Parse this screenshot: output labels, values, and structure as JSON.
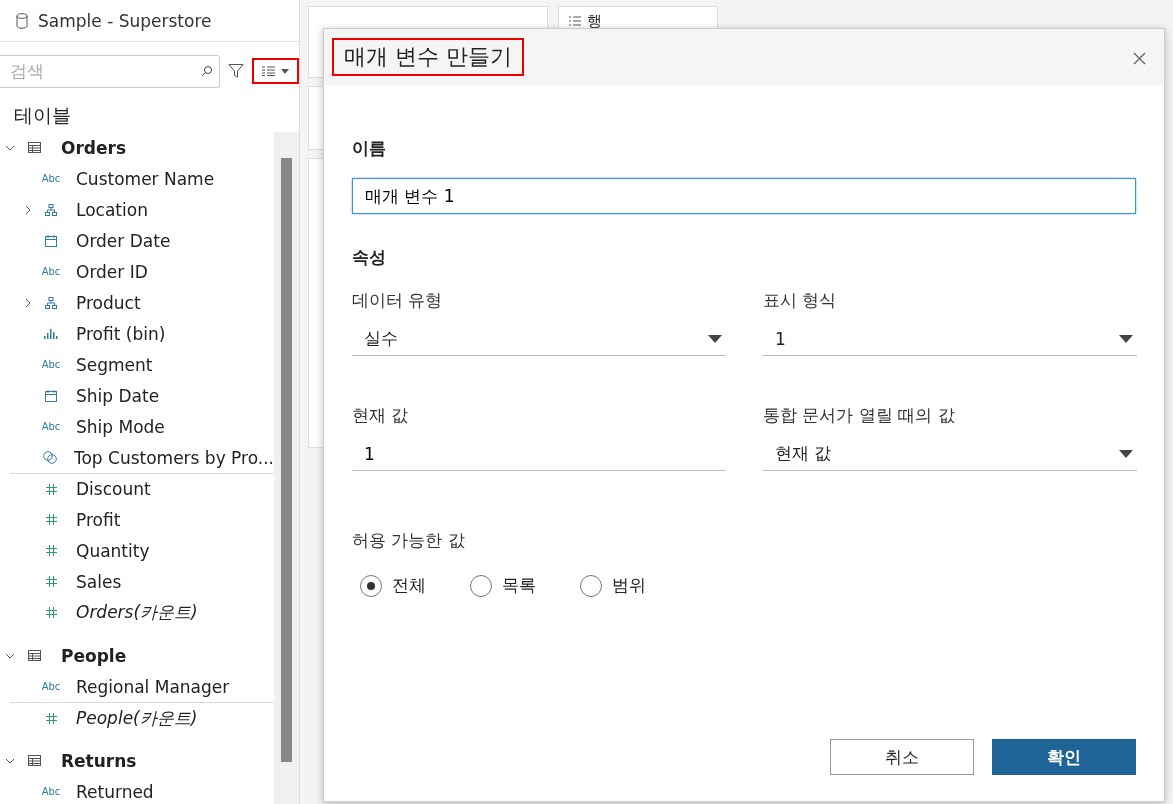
{
  "data_source": {
    "name": "Sample - Superstore"
  },
  "search": {
    "placeholder": "검색"
  },
  "tables_heading": "테이블",
  "tables": [
    {
      "name": "Orders",
      "expanded": true,
      "fields": [
        {
          "kind": "string",
          "badge": "Abc",
          "label": "Customer Name",
          "expandable": false,
          "generated": false
        },
        {
          "kind": "hierarchy",
          "label": "Location",
          "expandable": true,
          "generated": false
        },
        {
          "kind": "date",
          "label": "Order Date",
          "expandable": false,
          "generated": false
        },
        {
          "kind": "string",
          "badge": "Abc",
          "label": "Order ID",
          "expandable": false,
          "generated": false
        },
        {
          "kind": "hierarchy",
          "label": "Product",
          "expandable": true,
          "generated": false
        },
        {
          "kind": "bin",
          "label": "Profit (bin)",
          "expandable": false,
          "generated": false
        },
        {
          "kind": "string",
          "badge": "Abc",
          "label": "Segment",
          "expandable": false,
          "generated": false
        },
        {
          "kind": "date",
          "label": "Ship Date",
          "expandable": false,
          "generated": false
        },
        {
          "kind": "string",
          "badge": "Abc",
          "label": "Ship Mode",
          "expandable": false,
          "generated": false
        },
        {
          "kind": "set",
          "label": "Top Customers by Pro...",
          "expandable": false,
          "generated": false
        },
        {
          "kind": "measure",
          "label": "Discount",
          "expandable": false,
          "generated": false
        },
        {
          "kind": "measure",
          "label": "Profit",
          "expandable": false,
          "generated": false
        },
        {
          "kind": "measure",
          "label": "Quantity",
          "expandable": false,
          "generated": false
        },
        {
          "kind": "measure",
          "label": "Sales",
          "expandable": false,
          "generated": false
        },
        {
          "kind": "measure",
          "label": "Orders(카운트)",
          "expandable": false,
          "generated": true
        }
      ]
    },
    {
      "name": "People",
      "expanded": true,
      "fields": [
        {
          "kind": "string",
          "badge": "Abc",
          "label": "Regional Manager",
          "expandable": false,
          "generated": false
        },
        {
          "kind": "measure",
          "label": "People(카운트)",
          "expandable": false,
          "generated": true
        }
      ]
    },
    {
      "name": "Returns",
      "expanded": true,
      "fields": [
        {
          "kind": "string",
          "badge": "Abc",
          "label": "Returned",
          "expandable": false,
          "generated": false
        }
      ]
    }
  ],
  "shelf": {
    "label": "행"
  },
  "dialog": {
    "title": "매개 변수 만들기",
    "name_label": "이름",
    "name_value": "매개 변수 1",
    "properties_heading": "속성",
    "properties": [
      {
        "kind": "select",
        "label": "데이터 유형",
        "value": "실수"
      },
      {
        "kind": "select",
        "label": "표시 형식",
        "value": "1"
      },
      {
        "kind": "input",
        "label": "현재 값",
        "value": "1"
      },
      {
        "kind": "select",
        "label": "통합 문서가 열릴 때의 값",
        "value": "현재 값"
      }
    ],
    "allowed_label": "허용 가능한 값",
    "allowed_options": [
      {
        "label": "전체",
        "selected": true
      },
      {
        "label": "목록",
        "selected": false
      },
      {
        "label": "범위",
        "selected": false
      }
    ],
    "buttons": [
      {
        "label": "취소",
        "kind": "secondary"
      },
      {
        "label": "확인",
        "kind": "primary"
      }
    ]
  }
}
